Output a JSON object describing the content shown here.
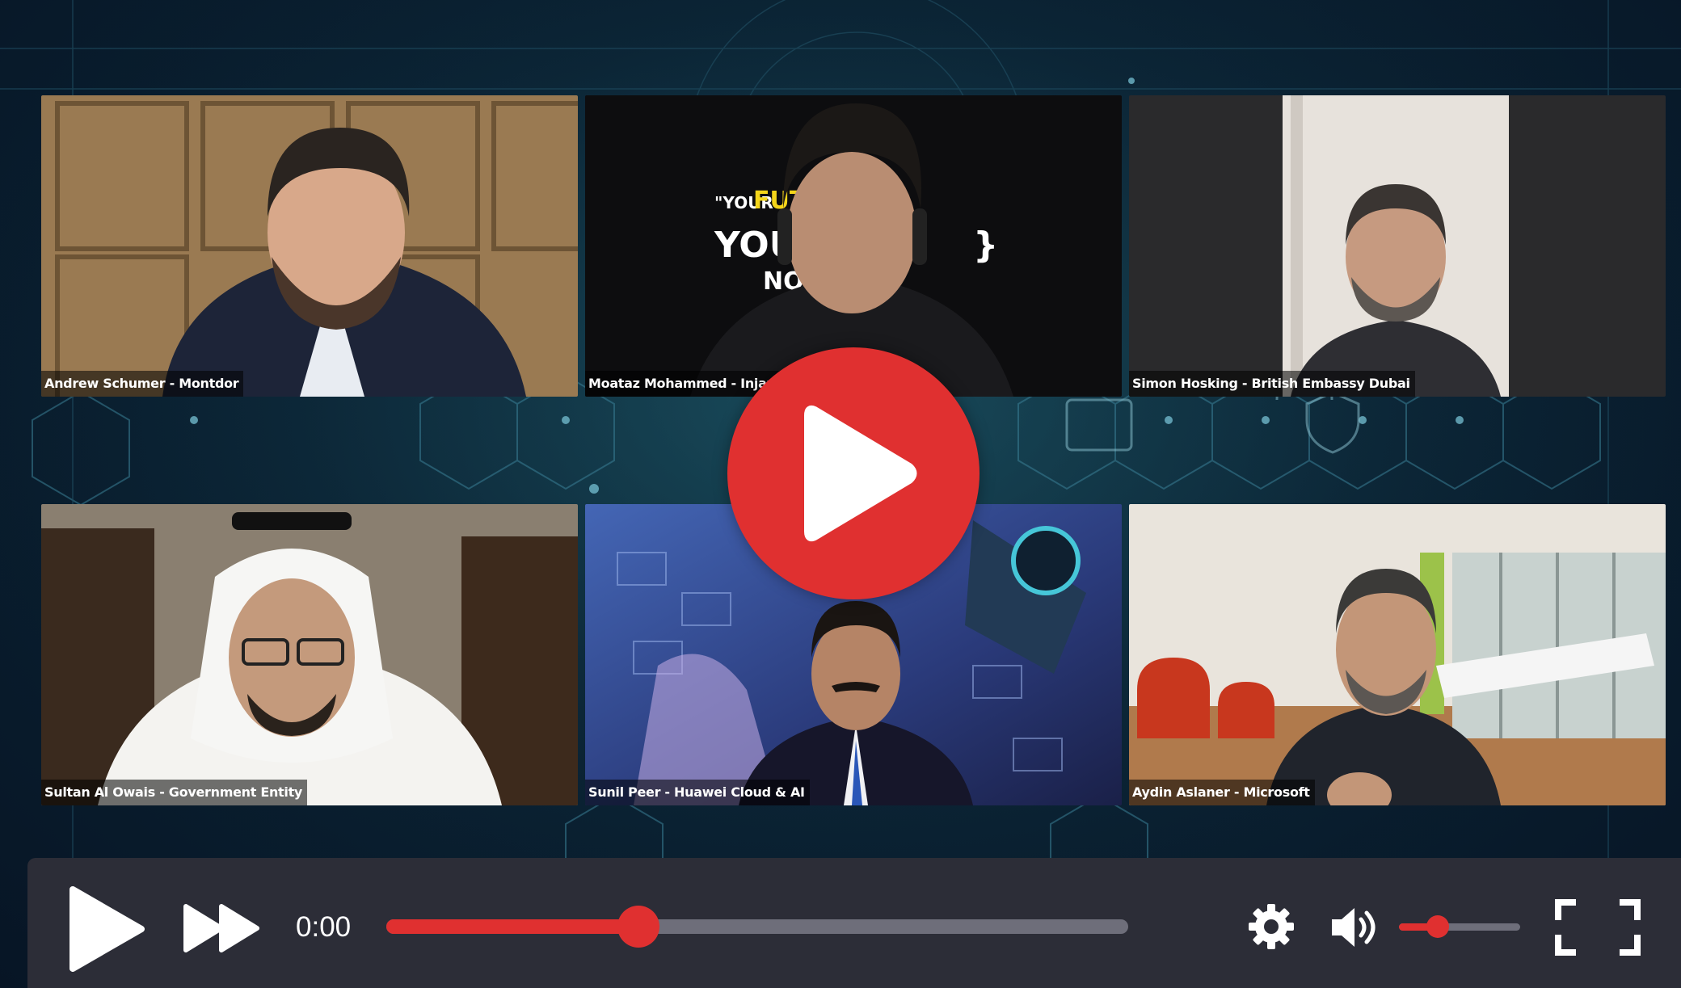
{
  "participants": [
    {
      "label": "Andrew Schumer - Montdor"
    },
    {
      "label": "Moataz Mohammed - Injazat"
    },
    {
      "label": "Simon Hosking - British Embassy Dubai"
    },
    {
      "label": "Sultan Al Owais - Government Entity"
    },
    {
      "label": "Sunil Peer - Huawei Cloud & AI"
    },
    {
      "label": "Aydin Aslaner - Microsoft"
    }
  ],
  "backdrop_text": {
    "line1_prefix": "\"YOUR",
    "line1_word": "FUTU",
    "line2": "YOU D",
    "line3": "NOT"
  },
  "player": {
    "current_time": "0:00",
    "progress": 0.34,
    "volume": 0.32,
    "accent_color": "#e03030",
    "controls_bg": "#2c2d37",
    "icons": [
      "big-play-icon",
      "play-icon",
      "fast-forward-icon",
      "settings-icon",
      "volume-icon",
      "fullscreen-icon"
    ]
  }
}
